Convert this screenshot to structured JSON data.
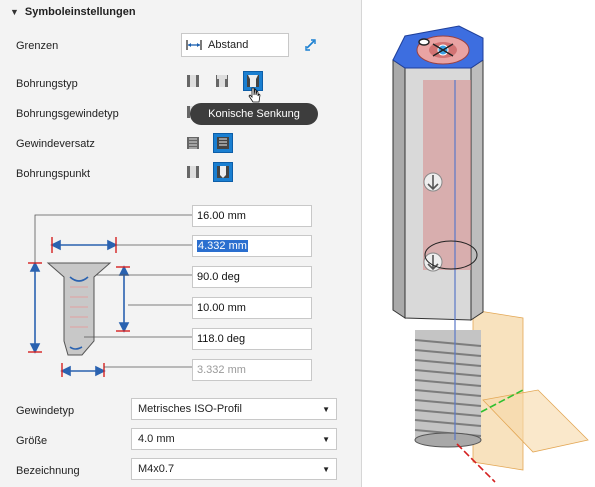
{
  "section": {
    "title": "Symboleinstellungen"
  },
  "grenzen": {
    "label": "Grenzen",
    "value": "Abstand"
  },
  "bohrungstyp": {
    "label": "Bohrungstyp"
  },
  "bohrungsgewindetyp": {
    "label": "Bohrungsgewindetyp"
  },
  "tooltip": {
    "text": "Konische Senkung"
  },
  "gewindeversatz": {
    "label": "Gewindeversatz"
  },
  "bohrungspunkt": {
    "label": "Bohrungspunkt"
  },
  "dimensions": {
    "depth": "16.00 mm",
    "countersink_diameter": "4.332 mm",
    "countersink_angle": "90.0 deg",
    "thread_depth": "10.00 mm",
    "drill_point_angle": "118.0 deg",
    "hole_diameter": "3.332 mm"
  },
  "gewindetyp": {
    "label": "Gewindetyp",
    "value": "Metrisches ISO-Profil"
  },
  "groesse": {
    "label": "Größe",
    "value": "4.0 mm"
  },
  "bezeichnung": {
    "label": "Bezeichnung",
    "value": "M4x0.7"
  },
  "colors": {
    "accent": "#1a7fd1",
    "tooltip_bg": "#3d3d3d",
    "selection": "#2b6fcf",
    "dimension_blue": "#2a62b0",
    "dimension_red": "#d42020"
  }
}
